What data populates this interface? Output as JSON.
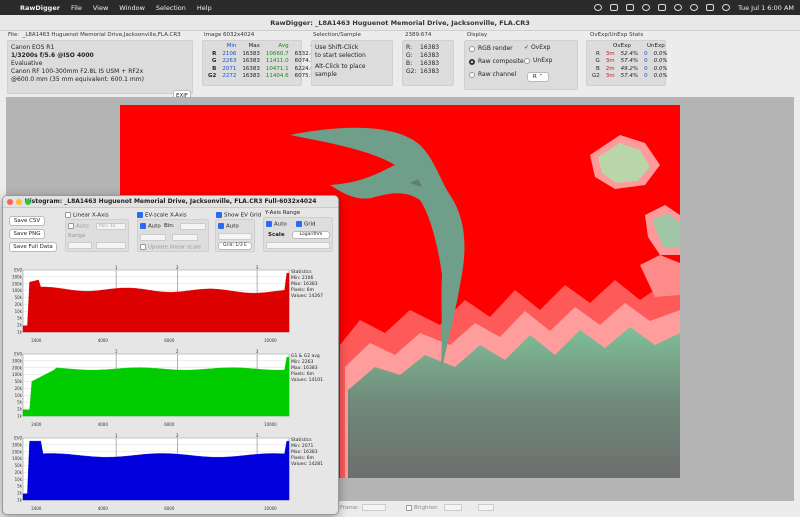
{
  "menubar": {
    "app_name": "RawDigger",
    "items": [
      "File",
      "View",
      "Window",
      "Selection",
      "Help"
    ],
    "clock": "Tue Jul 1  6:00 AM"
  },
  "window": {
    "title": "RawDigger: _L8A1463 Huguenot Memorial Drive, Jacksonville, FLA.CR3"
  },
  "file_info": {
    "label": "File:",
    "filename": "_L8A1463 Huguenot Memorial Drive,Jacksonville,FLA.CR3",
    "camera": "Canon EOS R1",
    "exposure": "1/3200s f/5.6 @ISO 4000",
    "metering": "Evaluative",
    "lens": "Canon RF 100-300mm F2.8L IS USM + RF2x",
    "focal": "@600.0 mm (35 mm equivalent: 600.1 mm)",
    "exif_button": "EXIF"
  },
  "image_stats": {
    "label": "Image 6032x4024",
    "headers": [
      "Min",
      "Max",
      "Avg",
      "σ"
    ],
    "rows": [
      {
        "ch": "R",
        "min": "2106",
        "max": "16383",
        "avg": "10660.7",
        "sd": "6332.4"
      },
      {
        "ch": "G",
        "min": "2263",
        "max": "16383",
        "avg": "11411.0",
        "sd": "6074.2"
      },
      {
        "ch": "B",
        "min": "2071",
        "max": "16383",
        "avg": "10471.1",
        "sd": "6224.0"
      },
      {
        "ch": "G2",
        "min": "2272",
        "max": "16383",
        "avg": "11404.6",
        "sd": "6075.9"
      }
    ]
  },
  "selection": {
    "label": "Selection/Sample",
    "line1": "Use Shift-Click",
    "line2": "to start selection",
    "line3": "Alt-Click to place",
    "line4": "sample"
  },
  "sample": {
    "label": "2389:674",
    "rows": [
      {
        "ch": "R:",
        "val": "16383"
      },
      {
        "ch": "G:",
        "val": "16383"
      },
      {
        "ch": "B:",
        "val": "16383"
      },
      {
        "ch": "G2:",
        "val": "16383"
      }
    ]
  },
  "display": {
    "label": "Display",
    "rgb_render": "RGB render",
    "raw_composite": "Raw composite",
    "raw_channel": "Raw channel",
    "ovexp": "OvExp",
    "unexp": "UnExp",
    "channel_select": "R"
  },
  "ovexp_stats": {
    "label": "OvExp/UnExp Stats",
    "h_ov": "OvExp",
    "h_un": "UnExp",
    "rows": [
      {
        "ch": "R",
        "ov": "3m",
        "ovp": "52.4%",
        "un": "0",
        "unp": "0.0%"
      },
      {
        "ch": "G",
        "ov": "3m",
        "ovp": "57.4%",
        "un": "0",
        "unp": "0.0%"
      },
      {
        "ch": "B",
        "ov": "2m",
        "ovp": "49.2%",
        "un": "0",
        "unp": "0.0%"
      },
      {
        "ch": "G2",
        "ov": "3m",
        "ovp": "57.4%",
        "un": "0",
        "unp": "0.0%"
      }
    ]
  },
  "bottom": {
    "frame_label": "Frame:",
    "brighten_label": "Brighten"
  },
  "histogram": {
    "title": "Histogram: _L8A1463 Huguenot Memorial Drive, Jacksonville, FLA.CR3 Full-6032x4024",
    "save_csv": "Save CSV",
    "save_png": "Save PNG",
    "save_full": "Save Full Data",
    "linear_x": "Linear X-Axis",
    "auto": "Auto",
    "min_placeholder": "Min: 10",
    "range": "Range",
    "ev_scale": "EV-scale X-Axis",
    "bin": "Bin:",
    "update_linear": "Update linear scale",
    "show_ev_grid": "Show EV Grid",
    "auto2": "Auto",
    "grid_val": "Grid: 1/3 E",
    "y_axis_range": "Y-Axis Range",
    "auto3": "Auto",
    "grid": "Grid",
    "scale": "Scale",
    "scale_val": "Logarithm",
    "panels": [
      {
        "channel": "R",
        "color": "#dd0000",
        "legend": [
          "Statistics",
          "Min: 2106",
          "Max: 16383",
          "Pixels: 6m",
          "Values: 14267"
        ]
      },
      {
        "channel": "G",
        "color": "#00cc00",
        "legend": [
          "G1 & G2 avg",
          "Min: 2263",
          "Max: 16383",
          "Pixels: 6m",
          "Values: 14101"
        ]
      },
      {
        "channel": "B",
        "color": "#0000dd",
        "legend": [
          "Statistics",
          "Min: 2071",
          "Max: 16383",
          "Pixels: 6m",
          "Values: 14281"
        ]
      }
    ],
    "y_ticks": [
      "EV0",
      "300k",
      "200k",
      "100k",
      "50k",
      "20k",
      "10k",
      "5k",
      "2k",
      "1k"
    ],
    "x_ticks": [
      "2400",
      "4000",
      "6000",
      "10000"
    ],
    "ev_ticks": [
      "1",
      "2",
      "3"
    ]
  }
}
